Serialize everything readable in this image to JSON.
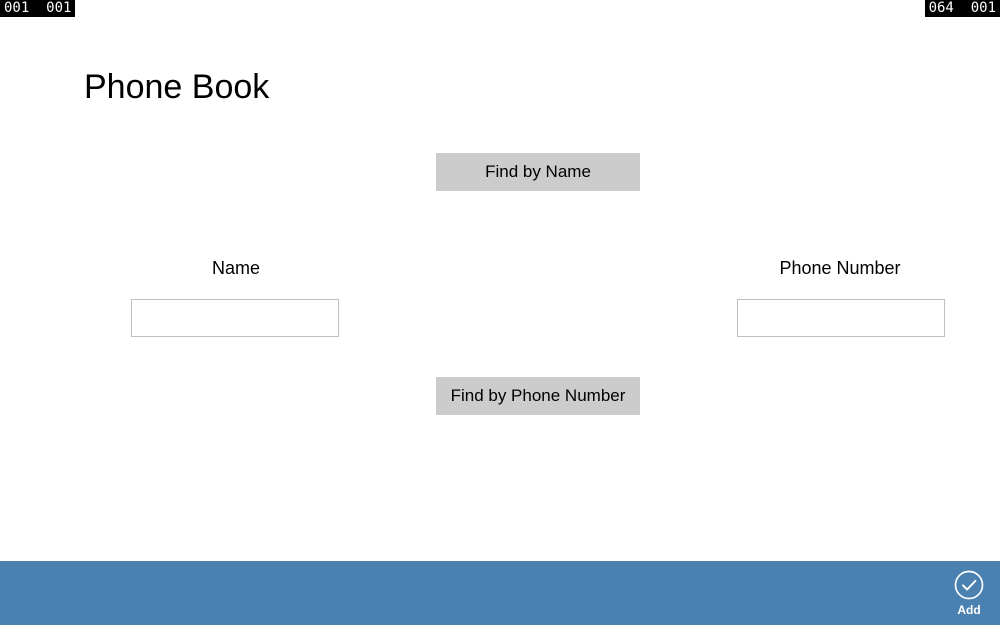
{
  "debug": {
    "top_left": "001  001",
    "top_right": "064  001"
  },
  "page": {
    "title": "Phone Book"
  },
  "buttons": {
    "find_by_name": "Find by Name",
    "find_by_phone": "Find by Phone Number"
  },
  "labels": {
    "name": "Name",
    "phone": "Phone Number"
  },
  "fields": {
    "name_value": "",
    "phone_value": ""
  },
  "appbar": {
    "add_label": "Add",
    "accent_color": "#4b81b1"
  }
}
